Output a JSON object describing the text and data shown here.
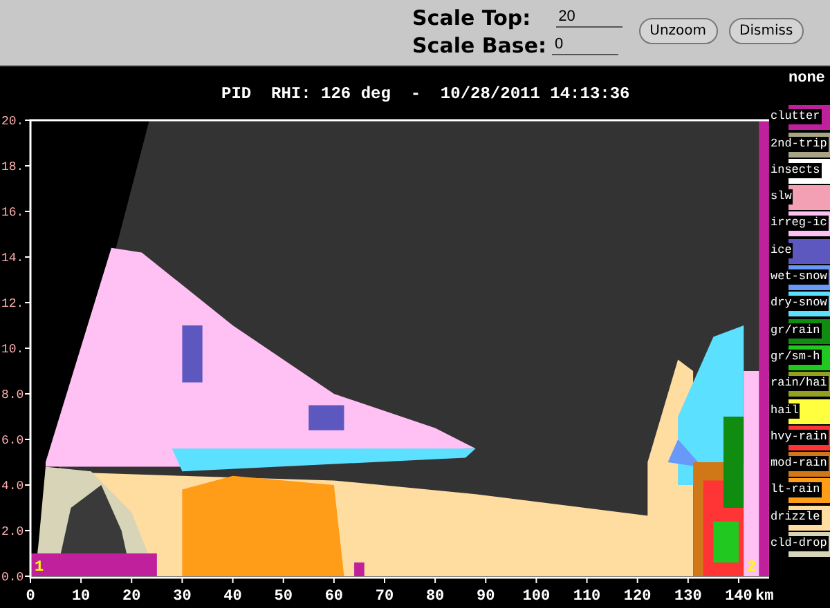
{
  "toolbar": {
    "fields": [
      {
        "label": "Scale Top:",
        "value": "20"
      },
      {
        "label": "Scale Base:",
        "value": "0"
      }
    ],
    "buttons": [
      "Unzoom",
      "Dismiss"
    ]
  },
  "plot": {
    "title": "PID  RHI: 126 deg  -  10/28/2011 14:13:36",
    "y_ticks": [
      "20.",
      "18.",
      "16.",
      "14.",
      "12.",
      "10.",
      "8.0",
      "6.0",
      "4.0",
      "2.0",
      "0.0"
    ],
    "x_ticks": [
      "0",
      "10",
      "20",
      "30",
      "40",
      "50",
      "60",
      "70",
      "80",
      "90",
      "100",
      "110",
      "120",
      "130",
      "140"
    ],
    "x_unit": "km",
    "range_markers": [
      "1",
      "2"
    ]
  },
  "legend": {
    "title": "none",
    "items": [
      {
        "label": "clutter",
        "color": "#c0209c"
      },
      {
        "label": "2nd-trip",
        "color": "#a8a484"
      },
      {
        "label": "insects",
        "color": "#ffffff"
      },
      {
        "label": "slw",
        "color": "#f4a0b4"
      },
      {
        "label": "irreg-ic",
        "color": "#ffc0f4"
      },
      {
        "label": "ice",
        "color": "#5c58c0"
      },
      {
        "label": "wet-snow",
        "color": "#6898f8"
      },
      {
        "label": "dry-snow",
        "color": "#5ce0ff"
      },
      {
        "label": "gr/rain",
        "color": "#108c10"
      },
      {
        "label": "gr/sm-h",
        "color": "#20c820"
      },
      {
        "label": "rain/hai",
        "color": "#94a020"
      },
      {
        "label": "hail",
        "color": "#ffff40"
      },
      {
        "label": "hvy-rain",
        "color": "#ff3434"
      },
      {
        "label": "mod-rain",
        "color": "#d07818"
      },
      {
        "label": "lt-rain",
        "color": "#ff9c18"
      },
      {
        "label": "drizzle",
        "color": "#ffdca0"
      },
      {
        "label": "cld-drop",
        "color": "#d8d4b8"
      }
    ]
  }
}
